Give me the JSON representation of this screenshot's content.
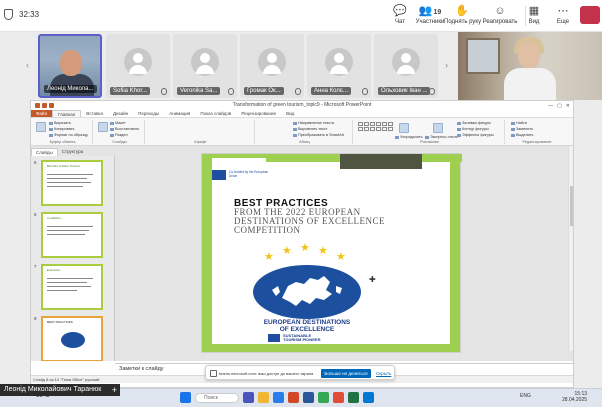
{
  "teams": {
    "timer": "32:33",
    "chat_label": "Чат",
    "participants_count": "19",
    "participants_label": "Участники",
    "raise_hand_label": "Поднять руку",
    "react_label": "Реагировать",
    "view_label": "Вид",
    "more_label": "Еще"
  },
  "participants": [
    {
      "name": "Леонід Микола..."
    },
    {
      "name": "Sofiia Khor..."
    },
    {
      "name": "Veronika Sa..."
    },
    {
      "name": "Громак Ок..."
    },
    {
      "name": "Анна Колє..."
    },
    {
      "name": "Ольховик Іван ..."
    }
  ],
  "powerpoint": {
    "window_title": "Transformation of green tourism_topic9 - Microsoft PowerPoint",
    "tabs": [
      "Файл",
      "Главная",
      "Вставка",
      "Дизайн",
      "Переходы",
      "Анимация",
      "Показ слайдов",
      "Рецензирование",
      "Вид"
    ],
    "ribbon": {
      "paste": "Вставить",
      "cut": "Вырезать",
      "copy": "Копировать",
      "format_painter": "Формат по образцу",
      "clipboard_group": "Буфер обмена",
      "new_slide": "Создать слайд",
      "layout": "Макет",
      "reset": "Восстановить",
      "section": "Раздел",
      "slides_group": "Слайды",
      "font_group": "Шрифт",
      "paragraph_group": "Абзац",
      "text_direction": "Направление текста",
      "align_text": "Выровнять текст",
      "smartart": "Преобразовать в SmartArt",
      "drawing_group": "Рисование",
      "arrange": "Упорядочить",
      "quick_styles": "Экспресс-стили",
      "shape_fill": "Заливка фигуры",
      "shape_outline": "Контур фигуры",
      "shape_effects": "Эффекты фигуры",
      "find": "Найти",
      "replace": "Заменить",
      "select": "Выделить",
      "editing_group": "Редактирование"
    },
    "pane_tabs": [
      "Слайды",
      "Структура"
    ],
    "thumbnails": [
      {
        "num": "5",
        "title": "Benefits of Eden Tourism"
      },
      {
        "num": "6",
        "title": "In addition,"
      },
      {
        "num": "7",
        "title": "Examples"
      },
      {
        "num": "8",
        "title": "BEST PRACTICES"
      }
    ],
    "slide": {
      "eu_text": "Co-funded by the European Union",
      "title_bold": "BEST PRACTICES",
      "title_line1": "FROM THE 2022 EUROPEAN",
      "title_line2": "DESTINATIONS OF EXCELLENCE",
      "title_line3": "COMPETITION",
      "eden_line1": "EUROPEAN DESTINATIONS",
      "eden_line2": "OF EXCELLENCE",
      "pioneer_line1": "SUSTAINABLE",
      "pioneer_line2": "TOURISM PIONEER"
    },
    "notes_placeholder": "Заметки к слайду",
    "status_text": "Слайд 8 из 10    \"Тема Office\"    русский"
  },
  "share_banner": {
    "text": "teams.microsoft.com: ваш доступ до вашего экрана",
    "stop_label": "Больше не делиться",
    "hide_label": "Скрыть"
  },
  "presenter": {
    "name": "Леонід Миколайович Таранюк"
  },
  "taskbar": {
    "weather": "18°C",
    "search_placeholder": "Поиск",
    "tray": "ENG",
    "time": "15:13",
    "date": "28.04.2025"
  }
}
